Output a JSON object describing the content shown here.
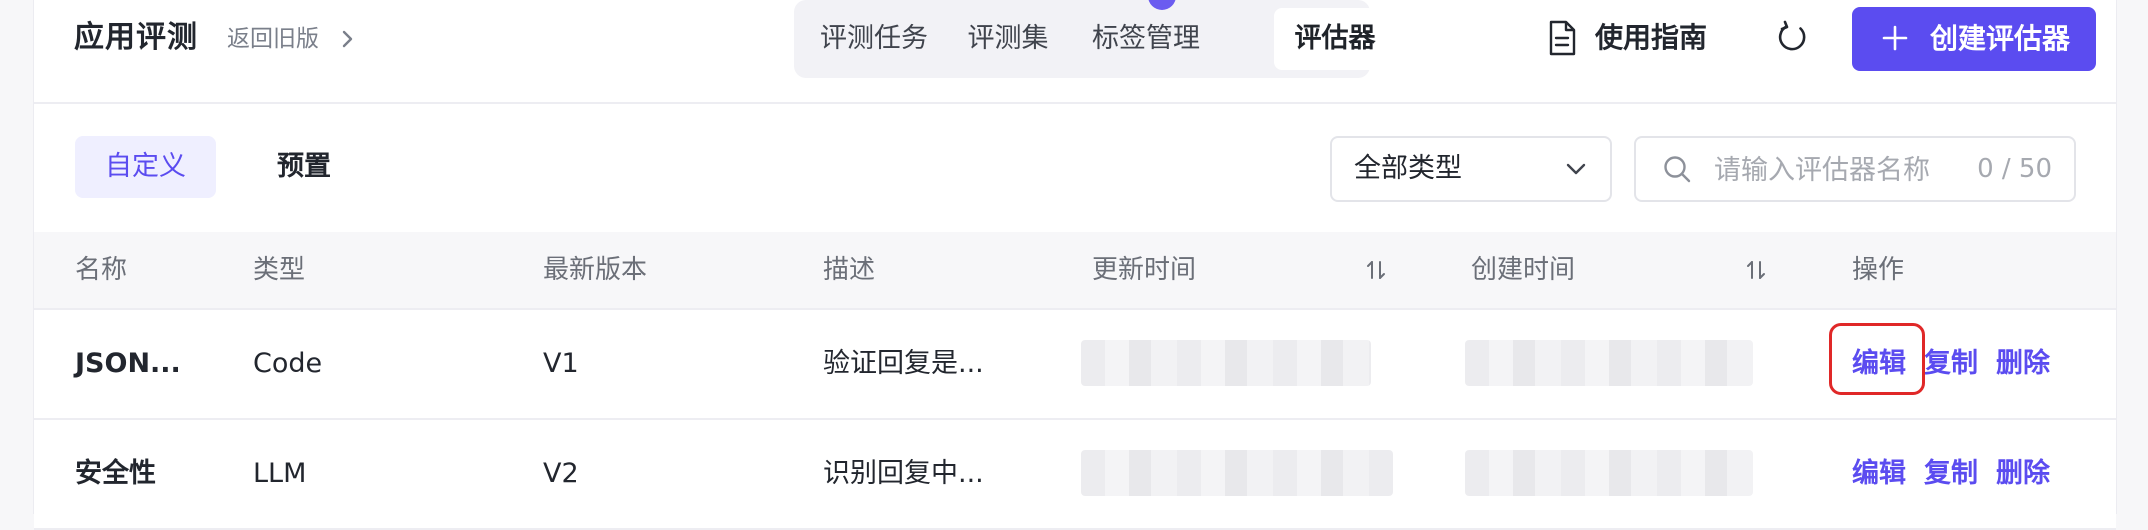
{
  "header": {
    "app_title": "应用评测",
    "back_link": "返回旧版",
    "tabs": [
      {
        "label": "评测任务",
        "active": false
      },
      {
        "label": "评测集",
        "active": false
      },
      {
        "label": "标签管理",
        "active": false
      },
      {
        "label": "评估器",
        "active": true
      }
    ],
    "guide_label": "使用指南",
    "create_button": "创建评估器"
  },
  "toolbar": {
    "segments": [
      {
        "label": "自定义",
        "active": true
      },
      {
        "label": "预置",
        "active": false
      }
    ],
    "type_filter": "全部类型",
    "search": {
      "placeholder": "请输入评估器名称",
      "counter": "0 / 50"
    }
  },
  "table": {
    "columns": [
      "名称",
      "类型",
      "最新版本",
      "描述",
      "更新时间",
      "创建时间",
      "操作"
    ],
    "rows": [
      {
        "name": "JSON...",
        "type": "Code",
        "version": "V1",
        "description": "验证回复是...",
        "actions": [
          "编辑",
          "复制",
          "删除"
        ]
      },
      {
        "name": "安全性",
        "type": "LLM",
        "version": "V2",
        "description": "识别回复中...",
        "actions": [
          "编辑",
          "复制",
          "删除"
        ]
      }
    ]
  },
  "colors": {
    "accent": "#5b4cf0",
    "highlight": "#e02828"
  },
  "icons": [
    "chevron-right-icon",
    "document-icon",
    "refresh-icon",
    "plus-icon",
    "chevron-down-icon",
    "search-icon",
    "sort-icon"
  ]
}
